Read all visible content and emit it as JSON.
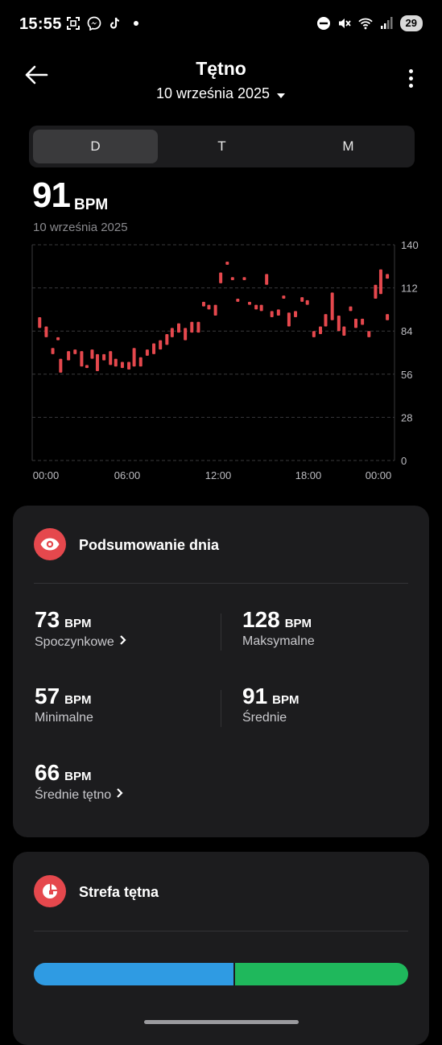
{
  "status_bar": {
    "time": "15:55",
    "battery": "29"
  },
  "header": {
    "title": "Tętno",
    "date": "10 września 2025"
  },
  "tabs": [
    {
      "label": "D",
      "active": true
    },
    {
      "label": "T",
      "active": false
    },
    {
      "label": "M",
      "active": false
    }
  ],
  "readout": {
    "value": "91",
    "unit": "BPM",
    "date": "10 września 2025"
  },
  "chart_data": {
    "type": "range-bar",
    "x_ticks": [
      "00:00",
      "06:00",
      "12:00",
      "18:00",
      "00:00"
    ],
    "y_ticks": [
      140,
      112,
      84,
      56,
      28,
      0
    ],
    "ylim": [
      0,
      140
    ],
    "xlim_hours": [
      0,
      24
    ],
    "color": "#e5484d",
    "bars": [
      [
        0.2,
        86,
        93
      ],
      [
        0.7,
        80,
        87
      ],
      [
        1.2,
        69,
        73
      ],
      [
        1.6,
        78,
        80
      ],
      [
        1.8,
        57,
        66
      ],
      [
        2.4,
        65,
        71
      ],
      [
        2.9,
        69,
        72
      ],
      [
        3.4,
        61,
        71
      ],
      [
        3.8,
        60,
        62
      ],
      [
        4.2,
        66,
        72
      ],
      [
        4.6,
        58,
        69
      ],
      [
        5.1,
        65,
        69
      ],
      [
        5.6,
        62,
        71
      ],
      [
        6.0,
        61,
        66
      ],
      [
        6.5,
        60,
        64
      ],
      [
        7.0,
        59,
        64
      ],
      [
        7.4,
        61,
        73
      ],
      [
        7.9,
        61,
        67
      ],
      [
        8.4,
        68,
        72
      ],
      [
        8.9,
        69,
        76
      ],
      [
        9.4,
        72,
        78
      ],
      [
        9.9,
        75,
        82
      ],
      [
        10.3,
        80,
        86
      ],
      [
        10.8,
        83,
        89
      ],
      [
        11.3,
        78,
        86
      ],
      [
        11.8,
        83,
        90
      ],
      [
        12.3,
        83,
        90
      ],
      [
        12.7,
        100,
        103
      ],
      [
        13.1,
        98,
        101
      ],
      [
        13.6,
        94,
        101
      ],
      [
        14.0,
        115,
        122
      ],
      [
        14.5,
        127,
        129
      ],
      [
        14.9,
        117,
        119
      ],
      [
        15.3,
        103,
        105
      ],
      [
        15.8,
        117,
        119
      ],
      [
        16.2,
        101,
        103
      ],
      [
        16.7,
        98,
        101
      ],
      [
        17.1,
        97,
        101
      ],
      [
        17.5,
        114,
        121
      ],
      [
        17.9,
        93,
        97
      ],
      [
        18.4,
        94,
        98
      ],
      [
        18.8,
        105,
        107
      ],
      [
        19.2,
        87,
        96
      ],
      [
        19.7,
        93,
        97
      ],
      [
        20.2,
        103,
        106
      ],
      [
        20.6,
        101,
        104
      ],
      [
        21.1,
        80,
        84
      ],
      [
        21.6,
        82,
        87
      ],
      [
        22.0,
        87,
        95
      ],
      [
        22.5,
        91,
        109
      ],
      [
        23.0,
        84,
        94
      ],
      [
        23.4,
        81,
        87
      ],
      [
        23.9,
        97,
        100
      ],
      [
        24.3,
        86,
        92
      ],
      [
        24.8,
        88,
        92
      ],
      [
        25.3,
        80,
        84
      ],
      [
        25.8,
        105,
        114
      ],
      [
        26.2,
        108,
        124
      ],
      [
        26.7,
        118,
        121
      ],
      [
        26.7,
        91,
        95
      ]
    ]
  },
  "summary": {
    "title": "Podsumowanie dnia",
    "resting": {
      "value": "73",
      "unit": "BPM",
      "label": "Spoczynkowe"
    },
    "max": {
      "value": "128",
      "unit": "BPM",
      "label": "Maksymalne"
    },
    "min": {
      "value": "57",
      "unit": "BPM",
      "label": "Minimalne"
    },
    "avg": {
      "value": "91",
      "unit": "BPM",
      "label": "Średnie"
    },
    "avg_hr": {
      "value": "66",
      "unit": "BPM",
      "label": "Średnie tętno"
    }
  },
  "zone": {
    "title": "Strefa tętna",
    "segments": [
      {
        "fraction": 0.535,
        "color": "#2f9be3"
      },
      {
        "fraction": 0.465,
        "color": "#1fb85c"
      }
    ]
  }
}
